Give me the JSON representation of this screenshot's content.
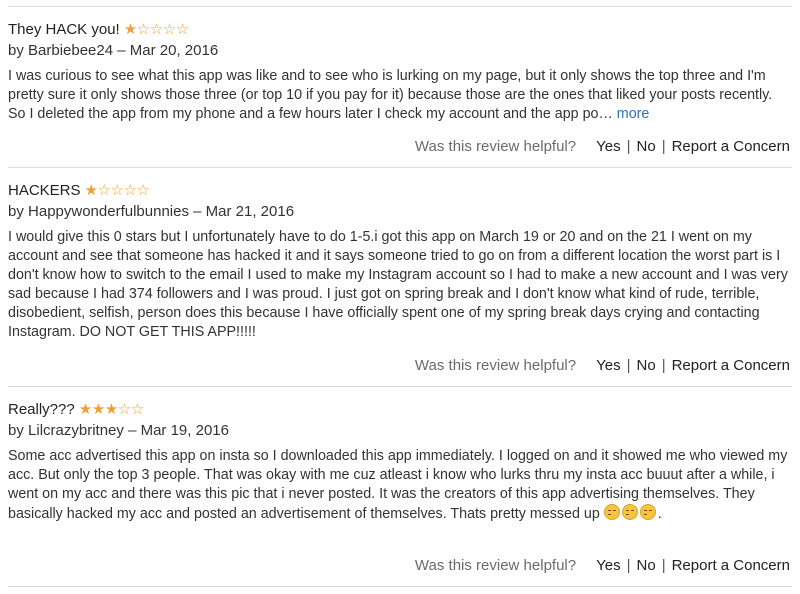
{
  "reviews": [
    {
      "title": "They HACK you!",
      "rating": 1,
      "author": "Barbiebee24",
      "date": "Mar 20, 2016",
      "body": "I was curious to see what this app was like and to see who is lurking on my page, but it only shows the top three and I'm pretty sure it only shows those three (or top 10 if you pay for it) because those are the ones that liked your posts recently. So I deleted the app from my phone and a few hours later I check my account and the app po…",
      "more_label": "more"
    },
    {
      "title": "HACKERS",
      "rating": 1,
      "author": "Happywonderfulbunnies",
      "date": "Mar 21, 2016",
      "body": "I would give this 0 stars but I unfortunately have to do 1-5.i got this app on March 19 or 20 and on the 21 I went on my account and see that someone has hacked it and it says someone tried to go on from a different location the worst part is I don't know how to switch to the email I used to make my Instagram account so I had to make a new account and I was very sad because I had 374 followers and I was proud. I just got on spring break and I don't know what kind of rude, terrible, disobedient, selfish, person does this because I have officially spent one of my spring break days crying and contacting Instagram. DO NOT GET THIS APP!!!!!"
    },
    {
      "title": "Really???",
      "rating": 3,
      "author": "Lilcrazybritney",
      "date": "Mar 19, 2016",
      "body": "Some acc advertised this app on insta so I downloaded this app immediately. I logged on and it showed me who viewed my acc. But only the top 3 people. That was okay with me cuz atleast i know who lurks thru my insta acc buuut after a while, i went on my acc and there was this pic that i never posted. It was the creators of this app advertising themselves. They basically hacked my acc and posted an advertisement of themselves. Thats pretty messed up",
      "body_suffix": "."
    }
  ],
  "helpful": {
    "question": "Was this review helpful?",
    "yes": "Yes",
    "no": "No",
    "report": "Report a Concern",
    "separator": "|"
  },
  "date_separator": "–",
  "by_label": "by",
  "star_max": 5,
  "colors": {
    "star": "#f0a030",
    "link": "#2f72b8",
    "separator": "#dcdcdc"
  }
}
